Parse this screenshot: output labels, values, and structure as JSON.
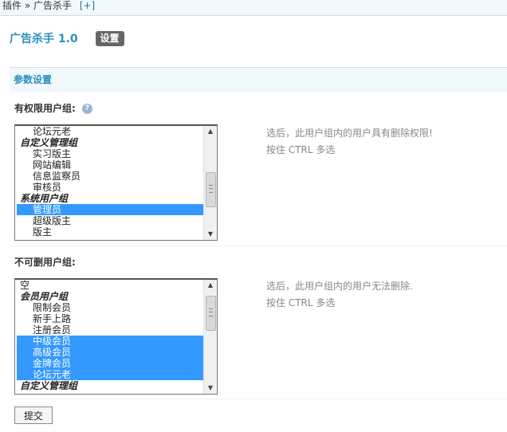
{
  "breadcrumb": {
    "text": "插件 » 广告杀手",
    "add_label": "[+]"
  },
  "plugin": {
    "title": "广告杀手 1.0",
    "tab_label": "设置"
  },
  "section": {
    "title": "参数设置"
  },
  "group1": {
    "label": "有权限用户组:",
    "help_icon": "help-icon",
    "options": [
      {
        "label": "论坛元老",
        "type": "item",
        "selected": false
      },
      {
        "label": "自定义管理组",
        "type": "group",
        "selected": false
      },
      {
        "label": "实习版主",
        "type": "item",
        "selected": false
      },
      {
        "label": "网站编辑",
        "type": "item",
        "selected": false
      },
      {
        "label": "信息监察员",
        "type": "item",
        "selected": false
      },
      {
        "label": "审核员",
        "type": "item",
        "selected": false
      },
      {
        "label": "系统用户组",
        "type": "group",
        "selected": false
      },
      {
        "label": "管理员",
        "type": "item",
        "selected": true
      },
      {
        "label": "超级版主",
        "type": "item",
        "selected": false
      },
      {
        "label": "版主",
        "type": "item",
        "selected": false
      }
    ],
    "hint_line1": "选后，此用户组内的用户具有删除权限!",
    "hint_line2": "按住 CTRL 多选"
  },
  "group2": {
    "label": "不可删用户组:",
    "options": [
      {
        "label": "空",
        "type": "top",
        "selected": false
      },
      {
        "label": "会员用户组",
        "type": "group",
        "selected": false
      },
      {
        "label": "限制会员",
        "type": "item",
        "selected": false
      },
      {
        "label": "新手上路",
        "type": "item",
        "selected": false
      },
      {
        "label": "注册会员",
        "type": "item",
        "selected": false
      },
      {
        "label": "中级会员",
        "type": "item",
        "selected": true
      },
      {
        "label": "高级会员",
        "type": "item",
        "selected": true
      },
      {
        "label": "金牌会员",
        "type": "item",
        "selected": true
      },
      {
        "label": "论坛元老",
        "type": "item",
        "selected": true
      },
      {
        "label": "自定义管理组",
        "type": "group",
        "selected": false
      }
    ],
    "hint_line1": "选后，此用户组内的用户无法删除.",
    "hint_line2": "按住 CTRL 多选"
  },
  "submit": {
    "label": "提交"
  }
}
